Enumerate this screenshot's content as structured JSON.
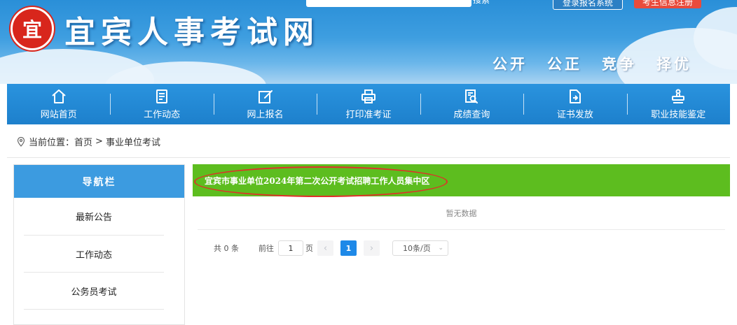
{
  "header": {
    "logo_glyph": "宜",
    "site_title": "宜宾人事考试网",
    "search_placeholder": "",
    "search_label": "搜索",
    "login_label": "登录报名系统",
    "register_label": "考生信息注册",
    "slogans": [
      "公开",
      "公正",
      "竞争",
      "择优"
    ]
  },
  "nav": [
    {
      "label": "网站首页",
      "icon": "home-icon"
    },
    {
      "label": "工作动态",
      "icon": "document-icon"
    },
    {
      "label": "网上报名",
      "icon": "edit-icon"
    },
    {
      "label": "打印准考证",
      "icon": "printer-icon"
    },
    {
      "label": "成绩查询",
      "icon": "search-document-icon"
    },
    {
      "label": "证书发放",
      "icon": "certificate-icon"
    },
    {
      "label": "职业技能鉴定",
      "icon": "stamp-icon"
    }
  ],
  "breadcrumb": {
    "prefix": "当前位置：",
    "home": "首页",
    "separator": ">",
    "current": "事业单位考试"
  },
  "sidebar": {
    "title": "导航栏",
    "items": [
      "最新公告",
      "工作动态",
      "公务员考试"
    ]
  },
  "main": {
    "title": "宜宾市事业单位2024年第二次公开考试招聘工作人员集中区",
    "empty_text": "暂无数据"
  },
  "pagination": {
    "total": "共 0 条",
    "goto_label": "前往",
    "goto_value": "1",
    "page_label": "页",
    "current_page": "1",
    "page_size": "10条/页"
  },
  "colors": {
    "banner_blue": "#3e9ee0",
    "nav_blue": "#1d80cc",
    "sidebar_head": "#3c9be0",
    "main_head_green": "#5dbd1f",
    "register_red": "#e94b3c",
    "annotation_red": "#e0302a",
    "active_page": "#1e89e8"
  }
}
